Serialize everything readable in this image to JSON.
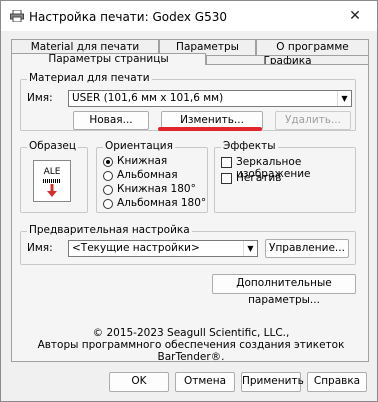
{
  "window": {
    "title": "Настройка печати: Godex G530",
    "close_glyph": "✕"
  },
  "tabs": {
    "back_row": [
      "Material для печати",
      "Параметры",
      "О программе"
    ],
    "front_row": [
      "Параметры страницы",
      "Графика"
    ],
    "active": "Параметры страницы"
  },
  "material": {
    "group_label": "Материал для печати",
    "name_label": "Имя:",
    "name_value": "USER (101,6 мм x 101,6 мм)",
    "new_button": "Новая...",
    "edit_button": "Изменить...",
    "delete_button": "Удалить..."
  },
  "sample": {
    "group_label": "Образец",
    "preview_text": "ALE"
  },
  "orientation": {
    "group_label": "Ориентация",
    "options": [
      "Книжная",
      "Альбомная",
      "Книжная 180°",
      "Альбомная 180°"
    ],
    "selected": "Книжная"
  },
  "effects": {
    "group_label": "Эффекты",
    "options": [
      "Зеркальное изображение",
      "Негатив"
    ]
  },
  "preset": {
    "group_label": "Предварительная настройка",
    "name_label": "Имя:",
    "name_value": "<Текущие настройки>",
    "manage_button": "Управление..."
  },
  "advanced_button": "Дополнительные параметры...",
  "copyright": {
    "line1": "© 2015-2023 Seagull Scientific, LLC.,",
    "line2": "Авторы программного обеспечения создания этикеток BarTender®."
  },
  "footer": {
    "ok": "OK",
    "cancel": "Отмена",
    "apply": "Применить",
    "help": "Справка"
  },
  "colors": {
    "highlight": "#e3262b",
    "accent_arrow": "#d32f2f"
  }
}
